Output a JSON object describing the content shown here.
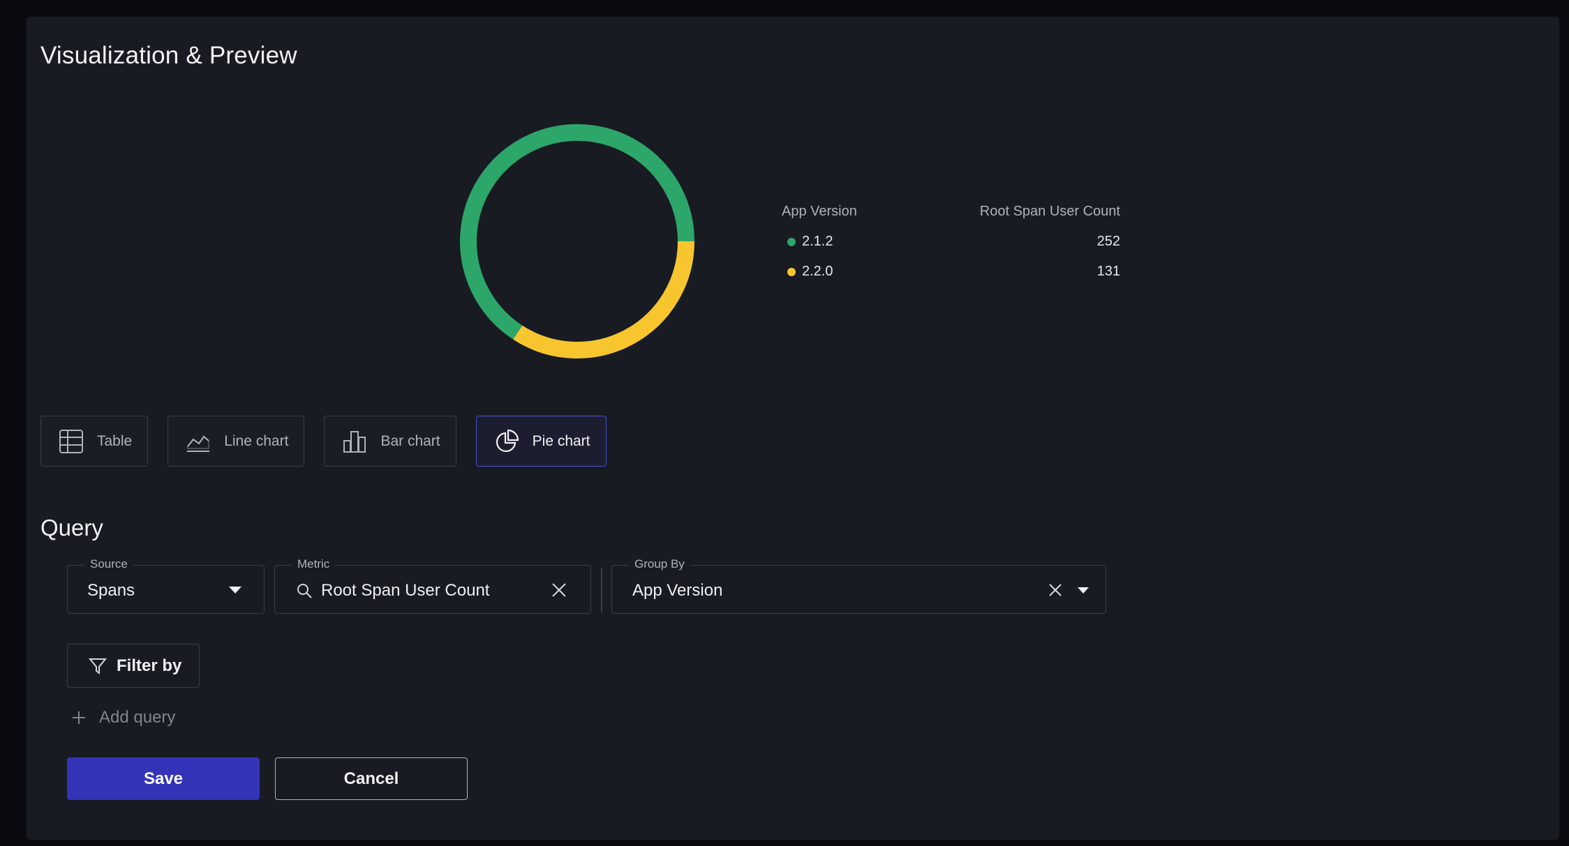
{
  "page": {
    "title": "Visualization & Preview"
  },
  "chart_data": {
    "type": "pie",
    "style": "donut",
    "legend_headers": [
      "App Version",
      "Root Span User Count"
    ],
    "legend_placement": "right",
    "slices": [
      {
        "label": "2.1.2",
        "value": 252,
        "color": "#2da66a"
      },
      {
        "label": "2.2.0",
        "value": 131,
        "color": "#f7c62f"
      }
    ]
  },
  "viz_types": [
    {
      "label": "Table",
      "icon": "table-icon",
      "active": false
    },
    {
      "label": "Line chart",
      "icon": "line-chart-icon",
      "active": false
    },
    {
      "label": "Bar chart",
      "icon": "bar-chart-icon",
      "active": false
    },
    {
      "label": "Pie chart",
      "icon": "pie-chart-icon",
      "active": true
    }
  ],
  "query": {
    "title": "Query",
    "source": {
      "label": "Source",
      "value": "Spans"
    },
    "metric": {
      "label": "Metric",
      "value": "Root Span User Count"
    },
    "group_by": {
      "label": "Group By",
      "value": "App Version"
    },
    "filter_label": "Filter by",
    "add_query_label": "Add query"
  },
  "actions": {
    "save": "Save",
    "cancel": "Cancel"
  },
  "colors": {
    "accent": "#3534b8",
    "active_border": "#4a4fd0"
  }
}
